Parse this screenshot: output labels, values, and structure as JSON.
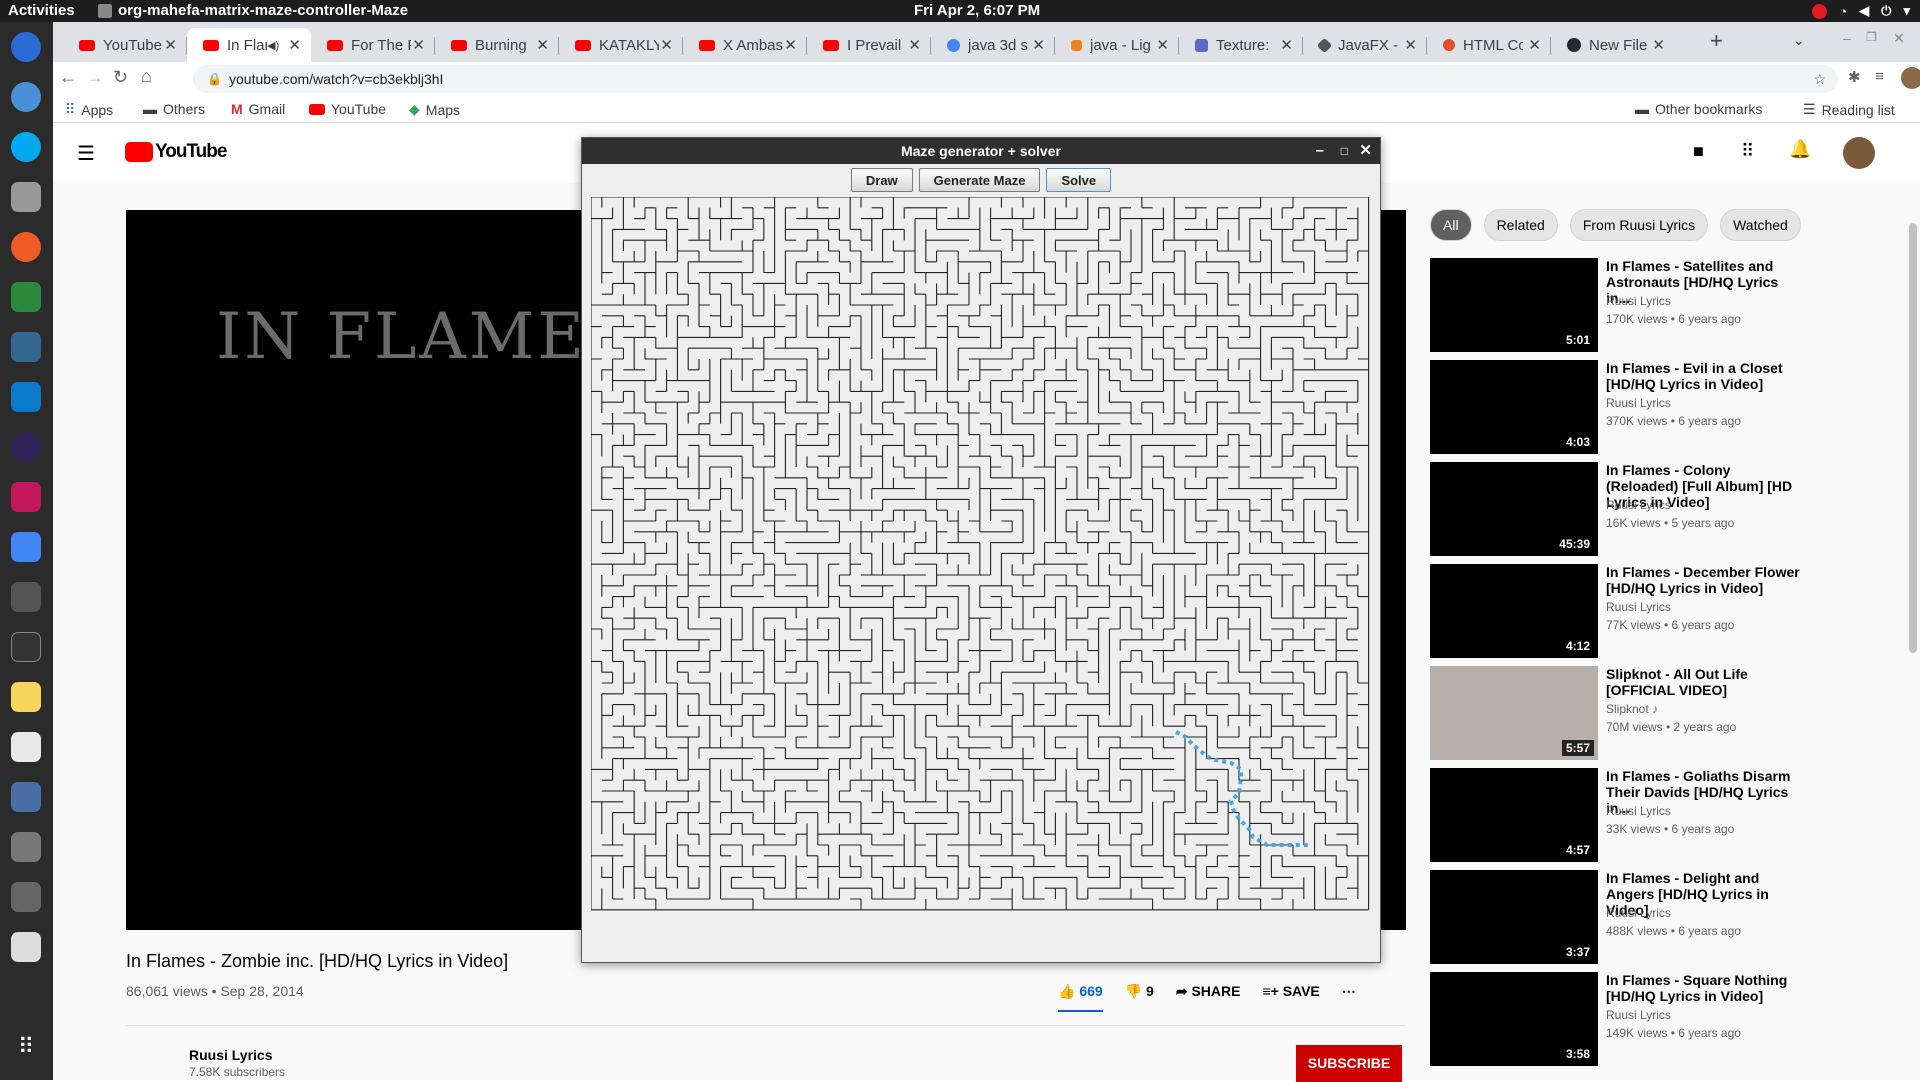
{
  "topbar": {
    "activities": "Activities",
    "app": "org-mahefa-matrix-maze-controller-Maze",
    "clock": "Fri Apr  2,  6:07 PM"
  },
  "tabs": [
    {
      "label": "YouTube"
    },
    {
      "label": "In Flar"
    },
    {
      "label": "For The F"
    },
    {
      "label": "Burning"
    },
    {
      "label": "KATAKLY"
    },
    {
      "label": "X Ambas"
    },
    {
      "label": "I Prevail"
    },
    {
      "label": "java 3d s"
    },
    {
      "label": "java - Lig"
    },
    {
      "label": "Texture:"
    },
    {
      "label": "JavaFX -"
    },
    {
      "label": "HTML Co"
    },
    {
      "label": "New File"
    }
  ],
  "address": {
    "url": "youtube.com/watch?v=cb3ekblj3hI"
  },
  "bookmarks": [
    {
      "label": "Apps"
    },
    {
      "label": "Others"
    },
    {
      "label": "Gmail"
    },
    {
      "label": "YouTube"
    },
    {
      "label": "Maps"
    }
  ],
  "bookmarks_right": {
    "other": "Other bookmarks",
    "reading": "Reading list"
  },
  "youtube": {
    "logo": "YouTube",
    "video_title": "In Flames - Zombie inc. [HD/HQ Lyrics in Video]",
    "views": "86,061 views • Sep 28, 2014",
    "likes": "669",
    "dislikes": "9",
    "share": "SHARE",
    "save": "SAVE",
    "channel": "Ruusi Lyrics",
    "subscribers": "7.58K subscribers",
    "subscribe": "SUBSCRIBE",
    "player_logo": "IN FLAMES",
    "chips": [
      {
        "label": "All"
      },
      {
        "label": "Related"
      },
      {
        "label": "From Ruusi Lyrics"
      },
      {
        "label": "Watched"
      }
    ],
    "recs": [
      {
        "title": "In Flames - Satellites and Astronauts [HD/HQ Lyrics in...",
        "channel": "Ruusi Lyrics",
        "meta": "170K views • 6 years ago",
        "dur": "5:01"
      },
      {
        "title": "In Flames - Evil in a Closet [HD/HQ Lyrics in Video]",
        "channel": "Ruusi Lyrics",
        "meta": "370K views • 6 years ago",
        "dur": "4:03"
      },
      {
        "title": "In Flames - Colony (Reloaded) [Full Album] [HD Lyrics in Video]",
        "channel": "Ruusi Lyrics",
        "meta": "16K views • 5 years ago",
        "dur": "45:39"
      },
      {
        "title": "In Flames - December Flower [HD/HQ Lyrics in Video]",
        "channel": "Ruusi Lyrics",
        "meta": "77K views • 6 years ago",
        "dur": "4:12"
      },
      {
        "title": "Slipknot - All Out Life [OFFICIAL VIDEO]",
        "channel": "Slipknot ♪",
        "meta": "70M views • 2 years ago",
        "dur": "5:57"
      },
      {
        "title": "In Flames - Goliaths Disarm Their Davids [HD/HQ Lyrics in...",
        "channel": "Ruusi Lyrics",
        "meta": "33K views • 6 years ago",
        "dur": "4:57"
      },
      {
        "title": "In Flames - Delight and Angers [HD/HQ Lyrics in Video]",
        "channel": "Ruusi Lyrics",
        "meta": "488K views • 6 years ago",
        "dur": "3:37"
      },
      {
        "title": "In Flames - Square Nothing [HD/HQ Lyrics in Video]",
        "channel": "Ruusi Lyrics",
        "meta": "149K views • 6 years ago",
        "dur": "3:58"
      }
    ]
  },
  "maze_window": {
    "title": "Maze generator + solver",
    "buttons": {
      "draw": "Draw",
      "generate": "Generate Maze",
      "solve": "Solve"
    }
  }
}
